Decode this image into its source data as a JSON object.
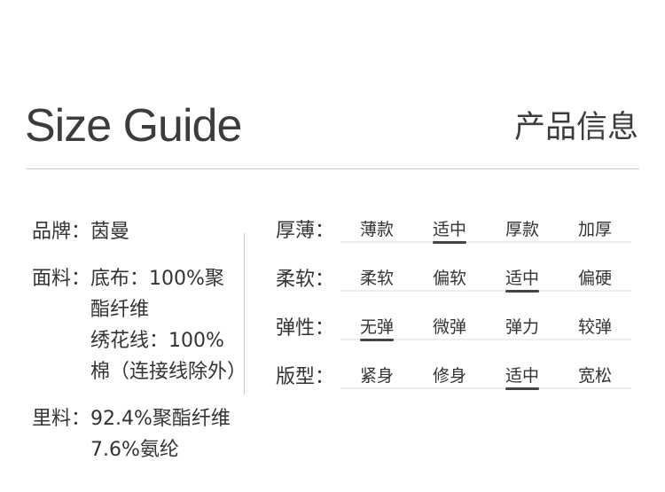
{
  "header": {
    "title_en": "Size Guide",
    "title_cn": "产品信息"
  },
  "info": {
    "brand": {
      "label": "品牌：",
      "values": [
        "茵曼"
      ]
    },
    "fabric": {
      "label": "面料：",
      "values": [
        "底布：100%聚酯纤维",
        "绣花线：100%棉（连接线除外）"
      ]
    },
    "lining": {
      "label": "里料：",
      "values": [
        "92.4%聚酯纤维 7.6%氨纶"
      ]
    }
  },
  "attributes": [
    {
      "label": "厚薄：",
      "options": [
        "薄款",
        "适中",
        "厚款",
        "加厚"
      ],
      "selected": "适中"
    },
    {
      "label": "柔软：",
      "options": [
        "柔软",
        "偏软",
        "适中",
        "偏硬"
      ],
      "selected": "适中"
    },
    {
      "label": "弹性：",
      "options": [
        "无弹",
        "微弹",
        "弹力",
        "较弹"
      ],
      "selected": "无弹"
    },
    {
      "label": "版型：",
      "options": [
        "紧身",
        "修身",
        "适中",
        "宽松"
      ],
      "selected": "适中"
    }
  ]
}
